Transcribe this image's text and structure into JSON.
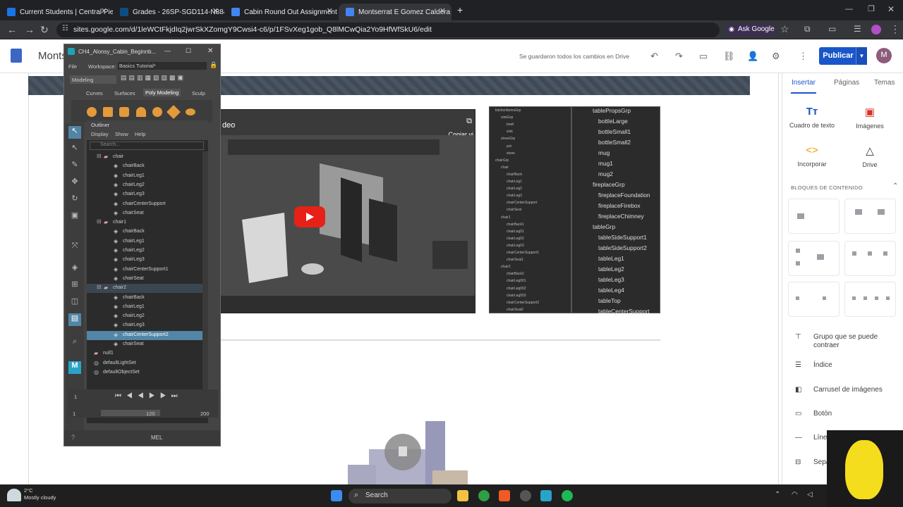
{
  "browser": {
    "tabs": [
      {
        "label": "Current Students | Central Piedmo",
        "color": "#1a73e8"
      },
      {
        "label": "Grades - 26SP-SGD114-N884: 3D M",
        "color": "#0f4c81"
      },
      {
        "label": "Cabin Round Out Assignment",
        "color": "#4285f4"
      },
      {
        "label": "Montserrat E Gomez Caldera P",
        "color": "#4285f4"
      }
    ],
    "url": "sites.google.com/d/1leWCtFkjdIq2jwrSkXZomgY9Cwsi4-c6/p/1FSvXeg1gob_Q8lMCwQia2Yo9HfWfSkU6/edit",
    "ask_google": "Ask Google"
  },
  "sites": {
    "title": "Monts",
    "saved_status": "Se guardaron todos los cambios en Drive",
    "publish_label": "Publicar",
    "avatar_letter": "M",
    "video_title": "deo",
    "copy_label": "Copiar vi",
    "panel_tabs": [
      "Insertar",
      "Páginas",
      "Temas"
    ],
    "insert_items": [
      "Cuadro de texto",
      "Imágenes",
      "Incorporar",
      "Drive"
    ],
    "blocks_heading": "BLOQUES DE CONTENIDO",
    "list_items": [
      "Grupo que se puede contraer",
      "Índice",
      "Carrusel de imágenes",
      "Botón",
      "Línea",
      "Sepa"
    ]
  },
  "screenshot_outliner": {
    "left_column": [
      "kitchenItemsGrp",
      "sinkGrp",
      "bowl",
      "sink",
      "stoveGrp",
      "pot",
      "stove",
      "chairGrp",
      "chair",
      "chairBack",
      "chairLeg1",
      "chairLeg2",
      "chairLeg3",
      "chairCenterSupport",
      "chairSeat",
      "chair1",
      "chairBack1",
      "chairLeg01",
      "chairLeg02",
      "chairLeg03",
      "chairCenterSupport1",
      "chairSeat1",
      "chair2",
      "chairBack2",
      "chairLeg001",
      "chairLeg002",
      "chairLeg003",
      "chairCenterSupport2",
      "chairSeat2"
    ],
    "right_column": [
      "tablePropsGrp",
      "bottleLarge",
      "bottleSmall1",
      "bottleSmall2",
      "mug",
      "mug1",
      "mug2",
      "fireplaceGrp",
      "fireplaceFoundation",
      "fireplaceFirebox",
      "fireplaceChimney",
      "tableGrp",
      "tableSideSupport1",
      "tableSideSupport2",
      "tableLeg1",
      "tableLeg2",
      "tableLeg3",
      "tableLeg4",
      "tableTop",
      "tableCenterSupport"
    ]
  },
  "maya": {
    "window_title": "CH4_Alonsy_Cabin_Beginnb...",
    "menu_file": "File",
    "workspace_label": "Workspace:",
    "workspace_value": "Basics Tutorial*",
    "mode_value": "Modeling",
    "shelf_tabs": [
      "Curves",
      "Surfaces",
      "Poly Modeling",
      "Sculp"
    ],
    "outliner_title": "Outliner",
    "outliner_menu": [
      "Display",
      "Show",
      "Help"
    ],
    "search_placeholder": "Search...",
    "rows": [
      {
        "label": "chair",
        "indent": 1,
        "type": "group"
      },
      {
        "label": "chairBack",
        "indent": 2,
        "type": "mesh"
      },
      {
        "label": "chairLeg1",
        "indent": 2,
        "type": "mesh"
      },
      {
        "label": "chairLeg2",
        "indent": 2,
        "type": "mesh"
      },
      {
        "label": "chairLeg3",
        "indent": 2,
        "type": "mesh"
      },
      {
        "label": "chairCenterSupport",
        "indent": 2,
        "type": "mesh"
      },
      {
        "label": "chairSeat",
        "indent": 2,
        "type": "mesh"
      },
      {
        "label": "chair1",
        "indent": 1,
        "type": "group"
      },
      {
        "label": "chairBack",
        "indent": 2,
        "type": "mesh"
      },
      {
        "label": "chairLeg1",
        "indent": 2,
        "type": "mesh"
      },
      {
        "label": "chairLeg2",
        "indent": 2,
        "type": "mesh"
      },
      {
        "label": "chairLeg3",
        "indent": 2,
        "type": "mesh"
      },
      {
        "label": "chairCenterSupport1",
        "indent": 2,
        "type": "mesh"
      },
      {
        "label": "chairSeat",
        "indent": 2,
        "type": "mesh"
      },
      {
        "label": "chair2",
        "indent": 1,
        "type": "group",
        "state": "hl"
      },
      {
        "label": "chairBack",
        "indent": 2,
        "type": "mesh"
      },
      {
        "label": "chairLeg1",
        "indent": 2,
        "type": "mesh"
      },
      {
        "label": "chairLeg2",
        "indent": 2,
        "type": "mesh"
      },
      {
        "label": "chairLeg3",
        "indent": 2,
        "type": "mesh"
      },
      {
        "label": "chairCenterSupport2",
        "indent": 2,
        "type": "mesh",
        "state": "sel"
      },
      {
        "label": "chairSeat",
        "indent": 2,
        "type": "mesh"
      },
      {
        "label": "null1",
        "indent": 0,
        "type": "group"
      },
      {
        "label": "defaultLightSet",
        "indent": 0,
        "type": "set"
      },
      {
        "label": "defaultObjectSet",
        "indent": 0,
        "type": "set"
      }
    ],
    "timeline": {
      "start": "1",
      "start2": "1",
      "end_inner": "120",
      "end": "200",
      "frame": "1"
    },
    "mel_label": "MEL"
  },
  "taskbar": {
    "weather_temp": "2°C",
    "weather_desc": "Mostly cloudy",
    "search_label": "Search"
  }
}
